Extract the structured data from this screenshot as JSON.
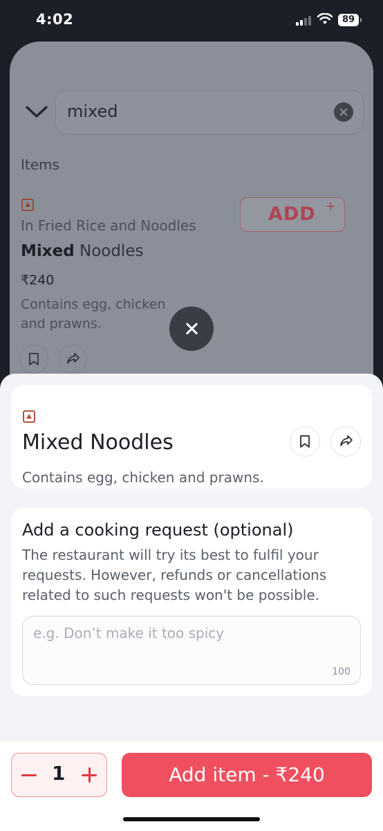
{
  "status_bar": {
    "time": "4:02",
    "battery": "89"
  },
  "background": {
    "search_value": "mixed",
    "section_heading": "Items",
    "item": {
      "category": "In Fried Rice and Noodles",
      "name_bold": "Mixed",
      "name_rest": " Noodles",
      "price": "₹240",
      "description": "Contains egg, chicken and prawns.",
      "add_label": "ADD",
      "add_plus": "+"
    }
  },
  "sheet": {
    "item_title": "Mixed Noodles",
    "item_description": "Contains egg, chicken and prawns.",
    "cooking_request": {
      "title": "Add a cooking request (optional)",
      "description": "The restaurant will try its best to fulfil your requests. However, refunds or cancellations related to such requests won't be possible.",
      "placeholder": "e.g. Don’t make it too spicy",
      "char_limit": "100"
    }
  },
  "footer": {
    "quantity": "1",
    "add_button_label": "Add item - ₹240"
  },
  "colors": {
    "accent": "#ef4f5f",
    "veg_marker": "#b5533c"
  }
}
